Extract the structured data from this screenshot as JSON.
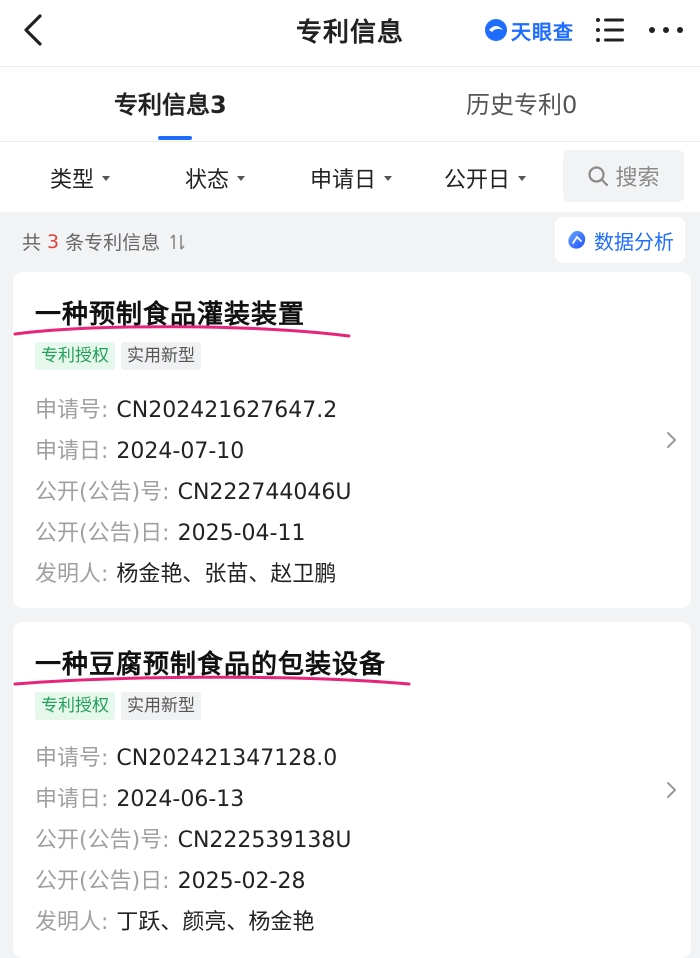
{
  "header": {
    "title": "专利信息",
    "logo_text": "天眼查",
    "icons": {
      "back": "chevron-left-icon",
      "menu": "list-icon",
      "more": "more-dots-icon"
    },
    "accent_color": "#1f6dff"
  },
  "tabs": [
    {
      "label": "专利信息3",
      "active": true
    },
    {
      "label": "历史专利0",
      "active": false
    }
  ],
  "filters": {
    "items": [
      "类型",
      "状态",
      "申请日",
      "公开日"
    ],
    "search_label": "搜索"
  },
  "summary": {
    "prefix": "共",
    "count": "3",
    "suffix": "条专利信息",
    "analysis_label": "数据分析"
  },
  "patents": [
    {
      "title": "一种预制食品灌装装置",
      "tags": [
        "专利授权",
        "实用新型"
      ],
      "fields": [
        {
          "label": "申请号:",
          "value": "CN202421627647.2"
        },
        {
          "label": "申请日:",
          "value": "2024-07-10"
        },
        {
          "label": "公开(公告)号:",
          "value": "CN222744046U"
        },
        {
          "label": "公开(公告)日:",
          "value": "2025-04-11"
        },
        {
          "label": "发明人:",
          "value": "杨金艳、张苗、赵卫鹏"
        }
      ]
    },
    {
      "title": "一种豆腐预制食品的包装设备",
      "tags": [
        "专利授权",
        "实用新型"
      ],
      "fields": [
        {
          "label": "申请号:",
          "value": "CN202421347128.0"
        },
        {
          "label": "申请日:",
          "value": "2024-06-13"
        },
        {
          "label": "公开(公告)号:",
          "value": "CN222539138U"
        },
        {
          "label": "公开(公告)日:",
          "value": "2025-02-28"
        },
        {
          "label": "发明人:",
          "value": "丁跃、颜亮、杨金艳"
        }
      ]
    }
  ]
}
